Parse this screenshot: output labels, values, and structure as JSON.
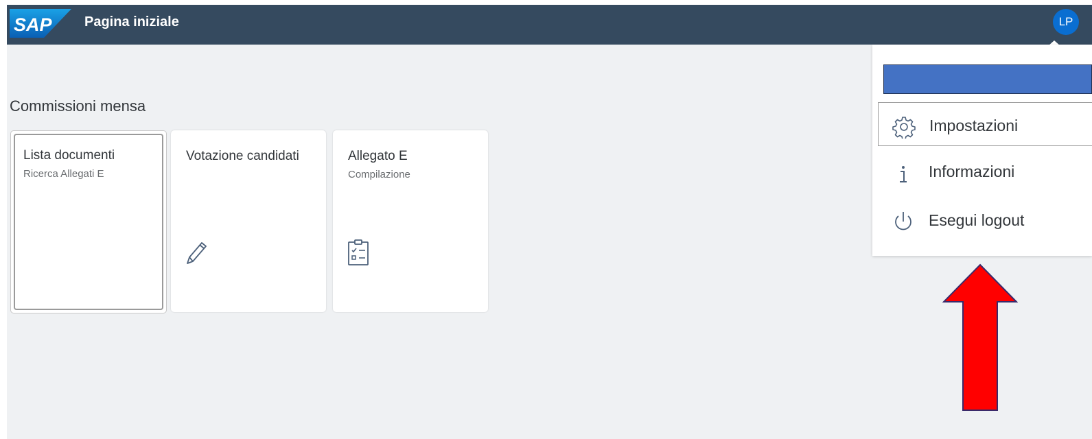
{
  "shellbar": {
    "logo_text": "SAP",
    "title": "Pagina iniziale",
    "avatar_initials": "LP"
  },
  "group": {
    "title": "Commissioni mensa"
  },
  "tiles": [
    {
      "title": "Lista documenti",
      "subtitle": "Ricerca Allegati E",
      "icon": "none"
    },
    {
      "title": "Votazione candidati",
      "subtitle": "",
      "icon": "pencil-icon"
    },
    {
      "title": "Allegato E",
      "subtitle": "Compilazione",
      "icon": "checklist-icon"
    }
  ],
  "user_menu": {
    "user_name_redacted_color": "#4472c4",
    "items": [
      {
        "label": "Impostazioni",
        "icon": "gear-icon"
      },
      {
        "label": "Informazioni",
        "icon": "info-icon"
      },
      {
        "label": "Esegui logout",
        "icon": "power-icon"
      }
    ]
  },
  "colors": {
    "shellbar": "#354a5f",
    "avatar": "#0a6ed1",
    "background": "#eff1f3",
    "arrow": "#ff0000"
  }
}
